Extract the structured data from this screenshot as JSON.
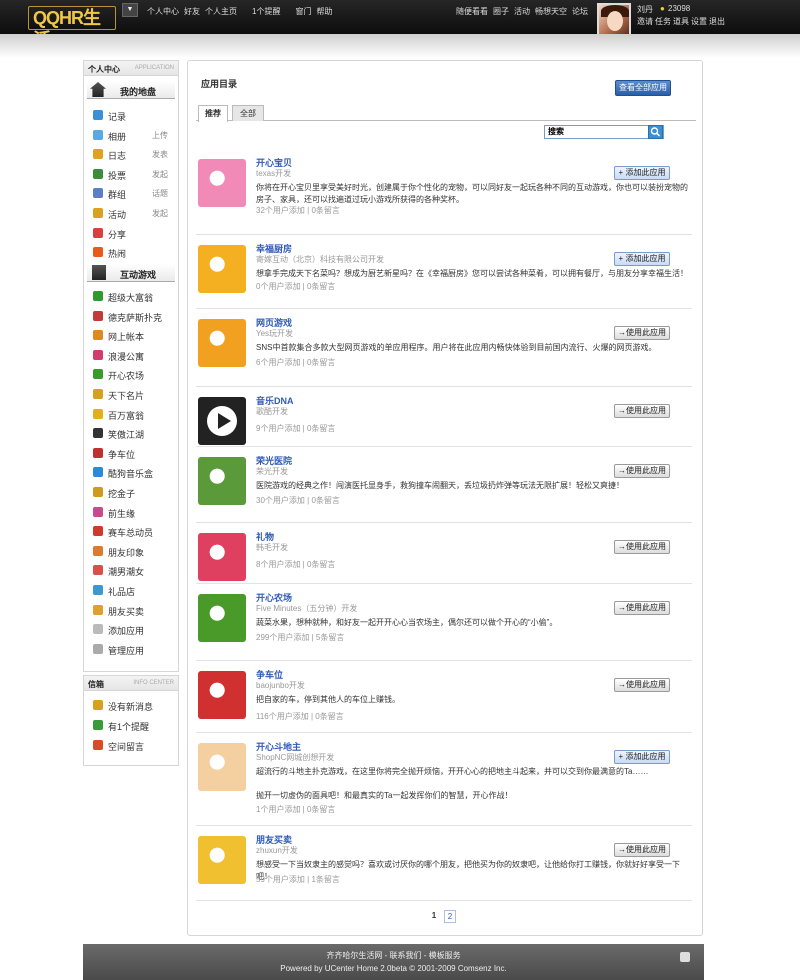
{
  "topbar": {
    "logo": "QQHR生活",
    "nav": [
      "个人中心",
      "好友",
      "个人主页",
      "1个提醒",
      "窗门",
      "帮助"
    ],
    "right": [
      "随便看看",
      "圈子",
      "活动",
      "畅想天空",
      "论坛"
    ],
    "user": "刘丹",
    "coins": "23098",
    "links": [
      "邀请",
      "任务",
      "道具",
      "设置",
      "退出"
    ]
  },
  "sidebar": {
    "head": "个人中心",
    "head_en": "APPLICATION",
    "sec1": "我的地盘",
    "items1": [
      {
        "label": "记录",
        "color": "#3a8fd6"
      },
      {
        "label": "相册",
        "color": "#5aa9e4",
        "right": "上传"
      },
      {
        "label": "日志",
        "color": "#e0a020",
        "right": "发表"
      },
      {
        "label": "投票",
        "color": "#3c8c3c",
        "right": "发起"
      },
      {
        "label": "群组",
        "color": "#5b7fc6",
        "right": "话题"
      },
      {
        "label": "活动",
        "color": "#d9a21e",
        "right": "发起"
      },
      {
        "label": "分享",
        "color": "#d84040"
      },
      {
        "label": "热闹",
        "color": "#e85a1a"
      }
    ],
    "sec2": "互动游戏",
    "items2": [
      {
        "label": "超级大富翁",
        "color": "#2f9a2f"
      },
      {
        "label": "德克萨斯扑克",
        "color": "#c43a3a"
      },
      {
        "label": "网上帐本",
        "color": "#e08a1a"
      },
      {
        "label": "浪漫公寓",
        "color": "#d23c6a"
      },
      {
        "label": "开心农场",
        "color": "#3a9a2a"
      },
      {
        "label": "天下名片",
        "color": "#d8a020"
      },
      {
        "label": "百万富翁",
        "color": "#e0b020"
      },
      {
        "label": "笑傲江湖",
        "color": "#333"
      },
      {
        "label": "争车位",
        "color": "#c03030"
      },
      {
        "label": "酷狗音乐盒",
        "color": "#2a8ad8"
      },
      {
        "label": "挖金子",
        "color": "#d09a20"
      },
      {
        "label": "前生缘",
        "color": "#c84a8a"
      },
      {
        "label": "赛车总动员",
        "color": "#d03a2a"
      },
      {
        "label": "朋友印象",
        "color": "#e07a2a"
      },
      {
        "label": "潮男潮女",
        "color": "#d8504a"
      },
      {
        "label": "礼品店",
        "color": "#3a9ad0"
      },
      {
        "label": "朋友买卖",
        "color": "#e0a030"
      },
      {
        "label": "添加应用",
        "color": "#bbb"
      },
      {
        "label": "管理应用",
        "color": "#aaa"
      }
    ],
    "box2_head": "信箱",
    "box2_en": "INFO CENTER",
    "items3": [
      {
        "label": "没有新消息",
        "color": "#d8a020"
      },
      {
        "label": "有1个提醒",
        "color": "#3a9a3a"
      },
      {
        "label": "空间留言",
        "color": "#d84a2a"
      }
    ]
  },
  "main": {
    "title": "应用目录",
    "viewall": "查看全部应用",
    "tabs": [
      "推荐",
      "全部"
    ],
    "search": "搜索",
    "pages": [
      "1",
      "2"
    ]
  },
  "apps": [
    {
      "name": "开心宝贝",
      "dev": "texas开发",
      "desc": "你将在开心宝贝里享受美好时光，创建属于你个性化的宠物，可以同好友一起玩各种不同的互动游戏，你也可以装扮宠物的房子、家具，还可以找遍道过玩小游戏所获得的各种奖杯。",
      "users": "32个用户添加",
      "msgs": "0条留言",
      "btn": "+ 添加此应用",
      "blue": true,
      "color": "#f28ab8"
    },
    {
      "name": "幸福厨房",
      "dev": "寄嫁互动（北京）科技有限公司开发",
      "desc": "想拿手完成天下名菜吗？想成为厨艺新星吗？在《幸福厨房》您可以尝试各种菜肴，可以拥有餐厅，与朋友分享幸福生活！",
      "users": "0个用户添加",
      "msgs": "0条留言",
      "btn": "+ 添加此应用",
      "blue": true,
      "color": "#f4b020"
    },
    {
      "name": "网页游戏",
      "dev": "Yes玩开发",
      "desc": "SNS中首款集合多款大型网页游戏的单应用程序。用户将在此应用内畅快体验到目前国内流行、火爆的网页游戏。",
      "users": "6个用户添加",
      "msgs": "0条留言",
      "btn": "→使用此应用",
      "blue": false,
      "color": "#f2a020"
    },
    {
      "name": "音乐DNA",
      "dev": "歌酷开发",
      "desc": "",
      "users": "9个用户添加",
      "msgs": "0条留言",
      "btn": "→使用此应用",
      "blue": false,
      "color": "#333"
    },
    {
      "name": "荣光医院",
      "dev": "荣光开发",
      "desc": "医院游戏的经典之作！闯演医托显身手，救狗撞车闹翻天，丢垃圾扔炸弹等玩法无限扩展！轻松又爽捷！",
      "users": "30个用户添加",
      "msgs": "0条留言",
      "btn": "→使用此应用",
      "blue": false,
      "color": "#5a9a3a"
    },
    {
      "name": "礼物",
      "dev": "韩毛开发",
      "desc": "",
      "users": "8个用户添加",
      "msgs": "0条留言",
      "btn": "→使用此应用",
      "blue": false,
      "color": "#e04060"
    },
    {
      "name": "开心农场",
      "dev": "Five Minutes（五分钟）开发",
      "desc": "蔬菜水果，想种就种，和好友一起开开心心当农场主，偶尔还可以做个开心的“小偷”。",
      "users": "299个用户添加",
      "msgs": "5条留言",
      "btn": "→使用此应用",
      "blue": false,
      "color": "#4a9a2a"
    },
    {
      "name": "争车位",
      "dev": "baojunbo开发",
      "desc": "把自家的车，停到其他人的车位上赚钱。",
      "users": "116个用户添加",
      "msgs": "0条留言",
      "btn": "→使用此应用",
      "blue": false,
      "color": "#d03030"
    },
    {
      "name": "开心斗地主",
      "dev": "ShopNC网城创想开发",
      "desc": "超流行的斗地主扑克游戏，在这里你将完全抛开烦恼，开开心心的把地主斗起来，并可以交到你最满意的Ta……",
      "desc2": "抛开一切虚伪的面具吧！和最真实的Ta一起发挥你们的智慧，开心作战！",
      "users": "1个用户添加",
      "msgs": "0条留言",
      "btn": "+ 添加此应用",
      "blue": true,
      "color": "#f4d0a0"
    },
    {
      "name": "朋友买卖",
      "dev": "zhuxun开发",
      "desc": "想感受一下当奴隶主的感觉吗？喜欢或讨厌你的哪个朋友，把他买为你的奴隶吧，让他给你打工赚钱，你就好好享受一下吧！",
      "users": "59个用户添加",
      "msgs": "1条留言",
      "btn": "→使用此应用",
      "blue": false,
      "color": "#f0c030"
    }
  ],
  "footer": {
    "line1": "齐齐哈尔生活网 - 联系我们 - 模板服务",
    "line2": "Powered by UCenter Home 2.0beta © 2001-2009 Comsenz Inc."
  }
}
